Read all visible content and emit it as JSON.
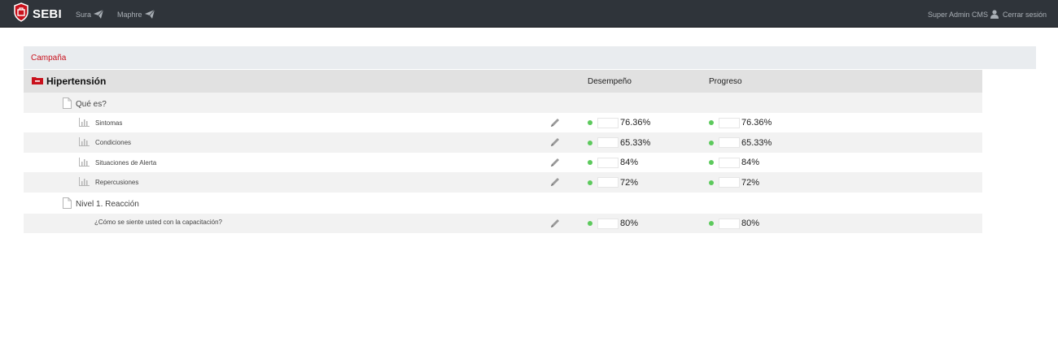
{
  "app": {
    "brand": "SEBI"
  },
  "nav": {
    "items": [
      {
        "label": "Sura",
        "icon": "paper-plane-icon"
      },
      {
        "label": "Maphre",
        "icon": "paper-plane-icon"
      }
    ]
  },
  "user": {
    "name": "Super Admin CMS",
    "icon": "user-icon",
    "logout": "Cerrar sesión"
  },
  "breadcrumb": "Campaña",
  "table": {
    "title": "Hipertensión",
    "title_icon": "folder-minus-icon",
    "col_performance": "Desempeño",
    "col_progress": "Progreso",
    "doc1": "Qué es?",
    "doc2": "Nivel 1. Reacción",
    "rows": [
      {
        "label": "Sintomas",
        "performance": "76.36%",
        "progress": "76.36%"
      },
      {
        "label": "Condiciones",
        "performance": "65.33%",
        "progress": "65.33%"
      },
      {
        "label": "Situaciones de Alerta",
        "performance": "84%",
        "progress": "84%"
      },
      {
        "label": "Repercusiones",
        "performance": "72%",
        "progress": "72%"
      },
      {
        "label": "¿Cómo se siente usted con la capacitación?",
        "performance": "80%",
        "progress": "80%"
      }
    ],
    "status_color": "#5cc95c"
  },
  "colors": {
    "topbar": "#2f343a",
    "accent": "#c9111c",
    "header_row": "#e1e1e1"
  }
}
